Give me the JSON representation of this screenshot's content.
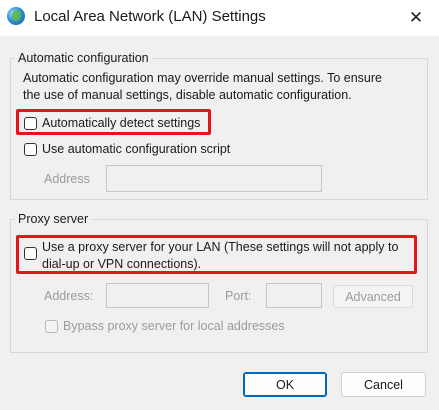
{
  "window": {
    "title": "Local Area Network (LAN) Settings",
    "close_glyph": "✕"
  },
  "auto_config": {
    "legend": "Automatic configuration",
    "description_line1": "Automatic configuration may override manual settings.  To ensure",
    "description_line2": "the use of manual settings, disable automatic configuration.",
    "detect_settings_label": "Automatically detect settings",
    "detect_settings_checked": false,
    "use_script_label": "Use automatic configuration script",
    "use_script_checked": false,
    "address_label": "Address",
    "address_value": ""
  },
  "proxy": {
    "legend": "Proxy server",
    "use_proxy_label_line1": "Use a proxy server for your LAN (These settings will not apply to",
    "use_proxy_label_line2": "dial-up or VPN connections).",
    "use_proxy_checked": false,
    "address_label": "Address:",
    "address_value": "",
    "port_label": "Port:",
    "port_value": "",
    "advanced_label": "Advanced",
    "bypass_label": "Bypass proxy server for local addresses",
    "bypass_checked": false
  },
  "footer": {
    "ok_label": "OK",
    "cancel_label": "Cancel"
  },
  "colors": {
    "highlight": "#e8141c",
    "primary_border": "#0067c0"
  },
  "icons": {
    "app": "globe-network-icon",
    "close": "close-icon"
  }
}
